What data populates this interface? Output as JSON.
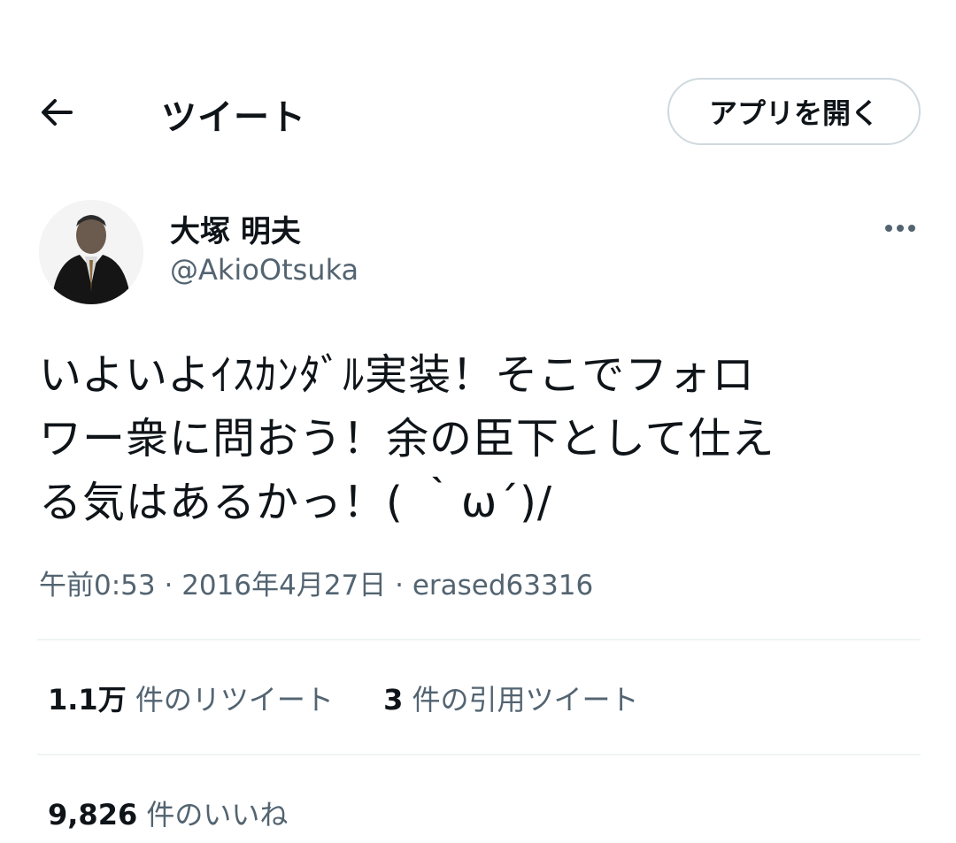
{
  "header": {
    "title": "ツイート",
    "open_app_label": "アプリを開く"
  },
  "author": {
    "display_name": "大塚 明夫",
    "handle": "@AkioOtsuka"
  },
  "tweet": {
    "text": "いよいよｲｽｶﾝﾀﾞﾙ実装！そこでフォロ\nワー衆に問おう！余の臣下として仕え\nる気はあるかっ！( ｀ω´)/",
    "time": "午前0:53",
    "date": "2016年4月27日",
    "source": "erased63316",
    "separator": "·"
  },
  "stats": {
    "retweets_count": "1.1万",
    "retweets_label": "件のリツイート",
    "quotes_count": "3",
    "quotes_label": "件の引用ツイート",
    "likes_count": "9,826",
    "likes_label": "件のいいね"
  },
  "icons": {
    "back": "arrow-left-icon",
    "more": "more-horizontal-icon"
  }
}
